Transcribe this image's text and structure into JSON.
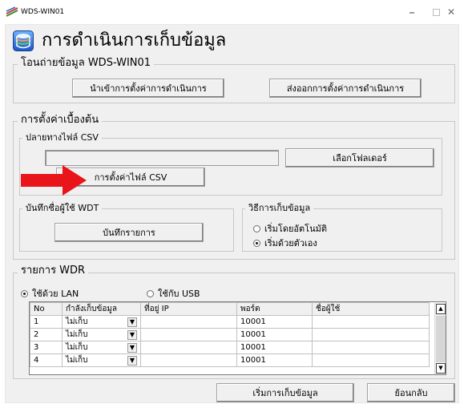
{
  "window": {
    "title": "WDS-WIN01",
    "minimize_glyph": "–",
    "close_glyph": "✕"
  },
  "header": {
    "title": "การดำเนินการเก็บข้อมูล",
    "icon": "data-collection-icon"
  },
  "transfer_group": {
    "legend": "โอนถ่ายข้อมูล WDS-WIN01",
    "import_button": "นำเข้าการตั้งค่าการดำเนินการ",
    "export_button": "ส่งออกการตั้งค่าการดำเนินการ"
  },
  "basic_settings": {
    "legend": "การตั้งค่าเบื้องต้น",
    "csv_destination": {
      "legend": "ปลายทางไฟล์ CSV",
      "path_value": "",
      "select_folder_button": "เลือกโฟลเดอร์",
      "csv_settings_button": "การตั้งค่าไฟล์ CSV"
    },
    "wdt_user_log": {
      "legend": "บันทึกชื่อผู้ใช้ WDT",
      "log_button": "บันทึกรายการ"
    },
    "collection_method": {
      "legend": "วิธีการเก็บข้อมูล",
      "options": [
        {
          "label": "เริ่มโดยอัตโนมัติ",
          "selected": false
        },
        {
          "label": "เริ่มด้วยตัวเอง",
          "selected": true
        }
      ]
    }
  },
  "wdr_list": {
    "legend": "รายการ WDR",
    "connection_options": [
      {
        "label": "ใช้ด้วย LAN",
        "selected": true
      },
      {
        "label": "ใช้กับ USB",
        "selected": false
      }
    ],
    "columns": [
      "No",
      "กำลังเก็บข้อมูล",
      "ที่อยู่ IP",
      "พอร์ต",
      "ชื่อผู้ใช้"
    ],
    "rows": [
      {
        "no": "1",
        "collecting": "ไม่เก็บ",
        "ip": "",
        "port": "10001",
        "user": ""
      },
      {
        "no": "2",
        "collecting": "ไม่เก็บ",
        "ip": "",
        "port": "10001",
        "user": ""
      },
      {
        "no": "3",
        "collecting": "ไม่เก็บ",
        "ip": "",
        "port": "10001",
        "user": ""
      },
      {
        "no": "4",
        "collecting": "ไม่เก็บ",
        "ip": "",
        "port": "10001",
        "user": ""
      }
    ]
  },
  "footer": {
    "start_button": "เริ่มการเก็บข้อมูล",
    "back_button": "ย้อนกลับ"
  },
  "colors": {
    "arrow": "#e8161b",
    "title_text": "#000000",
    "window_bg": "#f0f0f0"
  }
}
